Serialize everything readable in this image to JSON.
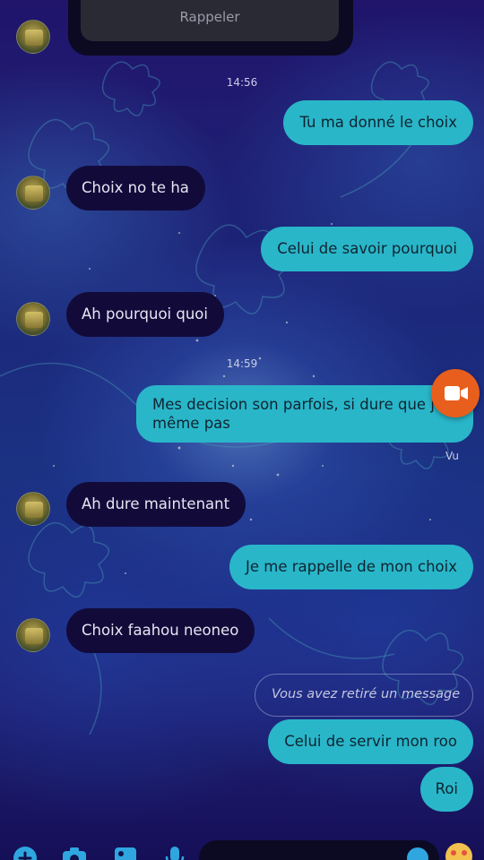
{
  "reply_card": {
    "label": "Rappeler"
  },
  "messages": [
    {
      "id": "t1",
      "type": "time",
      "text": "14:56"
    },
    {
      "id": "m1",
      "dir": "out",
      "text": "Tu ma donné le choix"
    },
    {
      "id": "m2",
      "dir": "in",
      "text": "Choix no te ha"
    },
    {
      "id": "m3",
      "dir": "out",
      "text": "Celui de savoir pourquoi"
    },
    {
      "id": "m4",
      "dir": "in",
      "text": "Ah pourquoi quoi"
    },
    {
      "id": "t2",
      "type": "time",
      "text": "14:59"
    },
    {
      "id": "m5",
      "dir": "out",
      "text": "Mes decision son parfois, si dure que je même pas"
    },
    {
      "id": "m6",
      "dir": "in",
      "text": "Ah dure maintenant"
    },
    {
      "id": "m7",
      "dir": "out",
      "text": "Je me rappelle de mon choix"
    },
    {
      "id": "m8",
      "dir": "in",
      "text": "Choix faahou neoneo"
    },
    {
      "id": "m9",
      "dir": "removed",
      "text": "Vous avez retiré un message"
    },
    {
      "id": "m10",
      "dir": "out",
      "text": "Celui de servir mon roo"
    },
    {
      "id": "m11",
      "dir": "out",
      "text": "Roi"
    }
  ],
  "seen_label": "Vu",
  "colors": {
    "incoming_bubble": "#120b3a",
    "outgoing_bubble": "#29b6c9",
    "video_button": "#e85f1d"
  },
  "icons": {
    "video_call": "video-camera-icon",
    "composer": [
      "plus-icon",
      "camera-icon",
      "image-icon",
      "microphone-icon",
      "emoji-icon"
    ]
  }
}
